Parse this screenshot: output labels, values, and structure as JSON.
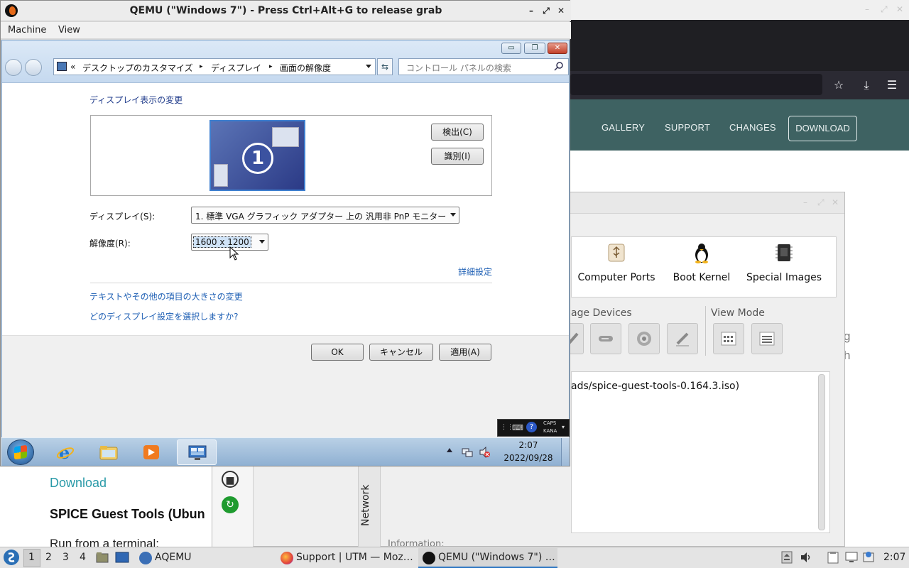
{
  "firefox": {
    "nav_links": [
      "GALLERY",
      "SUPPORT",
      "CHANGES"
    ],
    "nav_download": "DOWNLOAD",
    "page_partial_lines": [
      "g",
      "h"
    ],
    "download_link": "Download",
    "spice_heading": "SPICE Guest Tools (Ubun",
    "run_text": "Run from a terminal:"
  },
  "aqemu": {
    "big_buttons": [
      "Computer Ports",
      "Boot Kernel",
      "Special Images"
    ],
    "devices_label": "age Devices",
    "viewmode_label": "View Mode",
    "iso_path": "ads/spice-guest-tools-0.164.3.iso)",
    "network_tab": "Network",
    "info_label": "Information:"
  },
  "qemu": {
    "title": "QEMU (\"Windows 7\") - Press Ctrl+Alt+G to release grab",
    "menu": [
      "Machine",
      "View"
    ],
    "window_controls": [
      "–",
      "⤢",
      "✕"
    ]
  },
  "control_panel": {
    "breadcrumb": [
      "«",
      "デスクトップのカスタマイズ",
      "▸",
      "ディスプレイ",
      "▸",
      "画面の解像度"
    ],
    "search_placeholder": "コントロール パネルの検索",
    "heading": "ディスプレイ表示の変更",
    "monitor_number": "1",
    "detect_button": "検出(C)",
    "identify_button": "識別(I)",
    "display_label": "ディスプレイ(S):",
    "display_value": "1. 標準 VGA グラフィック アダプター 上の 汎用非 PnP モニター",
    "resolution_label": "解像度(R):",
    "resolution_value": "1600 x 1200",
    "advanced_link": "詳細設定",
    "link_text_size": "テキストやその他の項目の大きさの変更",
    "link_which_setting": "どのディスプレイ設定を選択しますか?",
    "ok_button": "OK",
    "cancel_button": "キャンセル",
    "apply_button": "適用(A)"
  },
  "ime_bar": {
    "caps": "CAPS",
    "kana": "KANA"
  },
  "win_taskbar": {
    "time": "2:07",
    "date": "2022/09/28"
  },
  "host_taskbar": {
    "desktops": [
      "1",
      "2",
      "3",
      "4"
    ],
    "tasks": [
      "AQEMU",
      "Support | UTM — Moz…",
      "QEMU (\"Windows 7\") …"
    ],
    "clock": "2:07"
  }
}
